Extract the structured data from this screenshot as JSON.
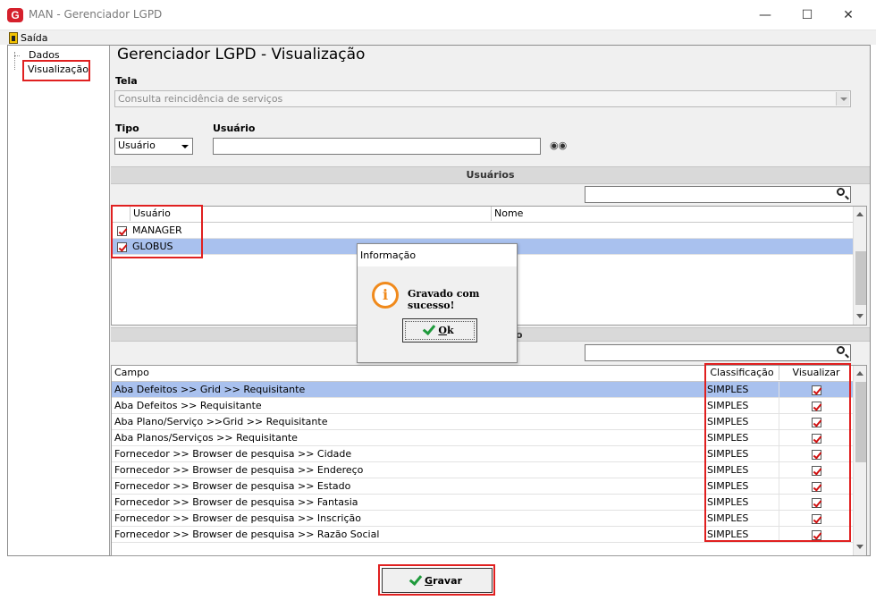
{
  "window": {
    "title": "MAN - Gerenciador LGPD",
    "logo_text": "G"
  },
  "menu": {
    "exit_label": "Saída"
  },
  "tree": {
    "items": [
      {
        "label": "Dados"
      },
      {
        "label": "Visualização"
      }
    ]
  },
  "page": {
    "title": "Gerenciador LGPD - Visualização"
  },
  "form": {
    "tela_label": "Tela",
    "tela_value": "Consulta reincidência de serviços",
    "tipo_label": "Tipo",
    "tipo_value": "Usuário",
    "usuario_label": "Usuário",
    "usuario_value": ""
  },
  "users_section": {
    "title": "Usuários",
    "columns": [
      "Usuário",
      "Nome"
    ],
    "rows": [
      {
        "user": "MANAGER",
        "name": "",
        "checked": true
      },
      {
        "user": "GLOBUS",
        "name": "",
        "checked": true
      }
    ]
  },
  "fields_section": {
    "title_suffix": "o",
    "columns": [
      "Campo",
      "Classificação",
      "Visualizar"
    ],
    "rows": [
      {
        "campo": "Aba Defeitos >> Grid >> Requisitante",
        "classificacao": "SIMPLES",
        "visualizar": true
      },
      {
        "campo": "Aba Defeitos >> Requisitante",
        "classificacao": "SIMPLES",
        "visualizar": true
      },
      {
        "campo": "Aba Plano/Serviço >>Grid >> Requisitante",
        "classificacao": "SIMPLES",
        "visualizar": true
      },
      {
        "campo": "Aba Planos/Serviços >> Requisitante",
        "classificacao": "SIMPLES",
        "visualizar": true
      },
      {
        "campo": "Fornecedor >> Browser de pesquisa >> Cidade",
        "classificacao": "SIMPLES",
        "visualizar": true
      },
      {
        "campo": "Fornecedor >> Browser de pesquisa >> Endereço",
        "classificacao": "SIMPLES",
        "visualizar": true
      },
      {
        "campo": "Fornecedor >> Browser de pesquisa >> Estado",
        "classificacao": "SIMPLES",
        "visualizar": true
      },
      {
        "campo": "Fornecedor >> Browser de pesquisa >> Fantasia",
        "classificacao": "SIMPLES",
        "visualizar": true
      },
      {
        "campo": "Fornecedor >> Browser de pesquisa >> Inscrição",
        "classificacao": "SIMPLES",
        "visualizar": true
      },
      {
        "campo": "Fornecedor >> Browser de pesquisa >> Razão Social",
        "classificacao": "SIMPLES",
        "visualizar": true
      }
    ]
  },
  "dialog": {
    "title": "Informação",
    "message": "Gravado com sucesso!",
    "ok_label": "Ok",
    "icon_text": "i"
  },
  "actions": {
    "save_label": "Gravar"
  },
  "colors": {
    "highlight": "#e02020",
    "selection": "#a9c1ee",
    "accent_orange": "#f08a1c",
    "ok_green": "#1f9a3c"
  }
}
